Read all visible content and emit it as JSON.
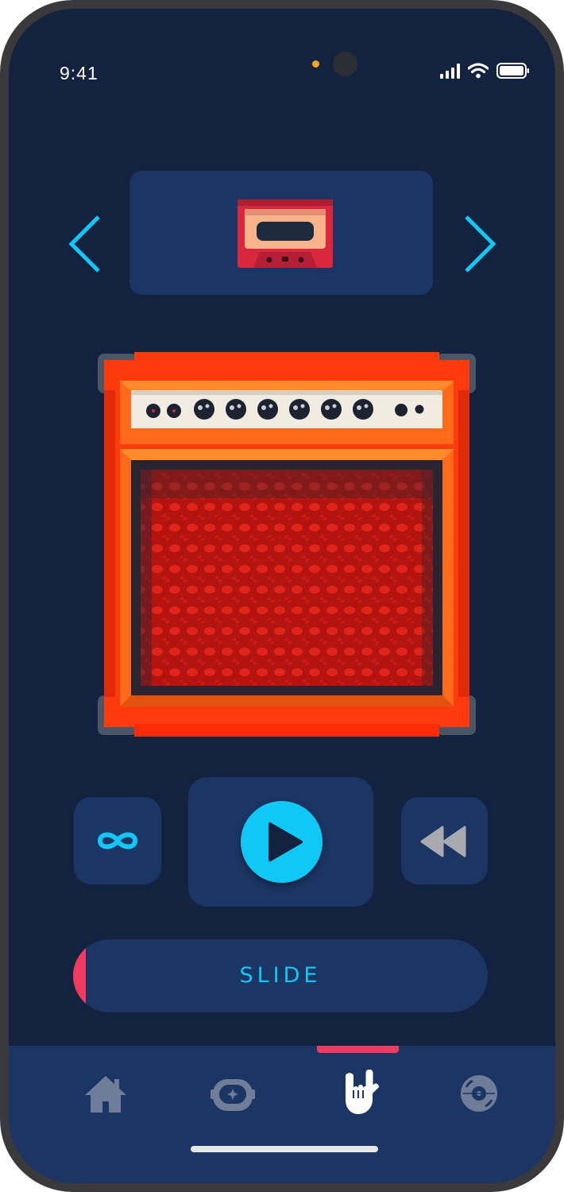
{
  "status_bar": {
    "time": "9:41"
  },
  "selector": {
    "prev_icon": "chevron-left-icon",
    "next_icon": "chevron-right-icon",
    "item_icon": "cassette-tape-icon"
  },
  "amplifier": {
    "icon": "guitar-amplifier-illustration"
  },
  "controls": {
    "loop_icon": "infinity-icon",
    "play_icon": "play-icon",
    "rewind_icon": "rewind-icon"
  },
  "slide": {
    "label": "SLIDE",
    "progress": 0.03
  },
  "tabbar": {
    "active_tab": "rock",
    "tabs": [
      {
        "id": "home",
        "icon": "home-icon"
      },
      {
        "id": "astro",
        "icon": "astronaut-helmet-icon"
      },
      {
        "id": "rock",
        "icon": "rock-hand-icon"
      },
      {
        "id": "disc",
        "icon": "vinyl-disc-icon"
      }
    ]
  },
  "colors": {
    "background": "#13223f",
    "card": "#1b3564",
    "accent_cyan": "#10c8f5",
    "accent_pink": "#f03a5f",
    "amp_orange": "#ff4a10"
  }
}
